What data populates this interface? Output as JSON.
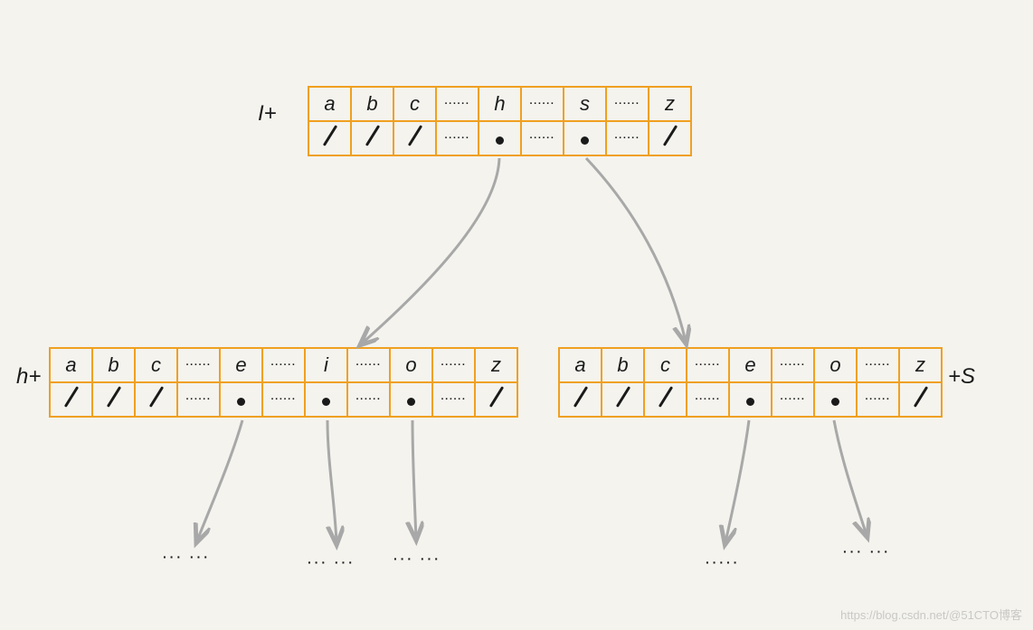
{
  "watermark": "https://blog.csdn.net/@51CTO博客",
  "rootLabel": "I+",
  "leftLabel": "h+",
  "rightLabel": "+S",
  "dotsSymbol": "······",
  "rootNode": {
    "letters": [
      "a",
      "b",
      "c",
      "",
      "h",
      "",
      "s",
      "",
      "z"
    ],
    "dotsAt": [
      3,
      5,
      7
    ],
    "pointers": [
      "slash",
      "slash",
      "slash",
      "dots",
      "bullet",
      "dots",
      "bullet",
      "dots",
      "slash"
    ]
  },
  "leftNode": {
    "letters": [
      "a",
      "b",
      "c",
      "",
      "e",
      "",
      "i",
      "",
      "o",
      "",
      "z"
    ],
    "dotsAt": [
      3,
      5,
      7,
      9
    ],
    "pointers": [
      "slash",
      "slash",
      "slash",
      "dots",
      "bullet",
      "dots",
      "bullet",
      "dots",
      "bullet",
      "dots",
      "slash"
    ]
  },
  "rightNode": {
    "letters": [
      "a",
      "b",
      "c",
      "",
      "e",
      "",
      "o",
      "",
      "z"
    ],
    "dotsAt": [
      3,
      5,
      7
    ],
    "pointers": [
      "slash",
      "slash",
      "slash",
      "dots",
      "bullet",
      "dots",
      "bullet",
      "dots",
      "slash"
    ]
  },
  "trailing": {
    "t1": "··· ···",
    "t2": "··· ···",
    "t3": "··· ···",
    "t4": "·····",
    "t5": "··· ···"
  }
}
